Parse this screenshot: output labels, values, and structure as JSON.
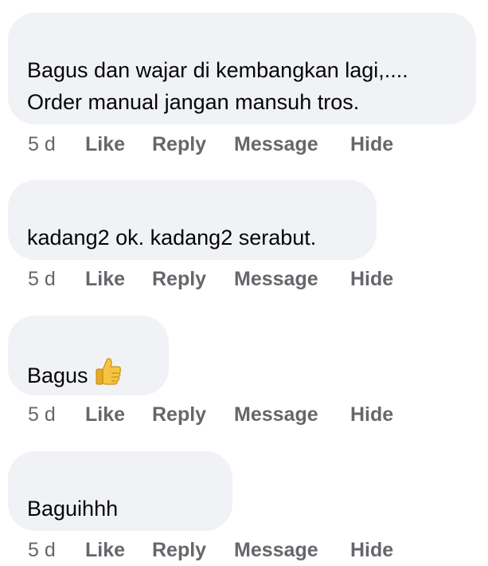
{
  "comments": [
    {
      "lines": [
        "Bagus dan wajar di kembangkan lagi,....",
        "Order manual jangan mansuh tros."
      ],
      "time": "5 d",
      "actions": [
        "Like",
        "Reply",
        "Message",
        "Hide"
      ]
    },
    {
      "lines": [
        "kadang2 ok. kadang2 serabut."
      ],
      "time": "5 d",
      "actions": [
        "Like",
        "Reply",
        "Message",
        "Hide"
      ]
    },
    {
      "lines": [
        "Bagus"
      ],
      "emoji": "thumbs-up-icon",
      "time": "5 d",
      "actions": [
        "Like",
        "Reply",
        "Message",
        "Hide"
      ]
    },
    {
      "lines": [
        "Baguihhh"
      ],
      "time": "5 d",
      "actions": [
        "Like",
        "Reply",
        "Message",
        "Hide"
      ]
    }
  ],
  "colors": {
    "bubble_bg": "#f0f2f5",
    "text": "#050505",
    "meta_text": "#65676b",
    "emoji": "#f5c542"
  }
}
